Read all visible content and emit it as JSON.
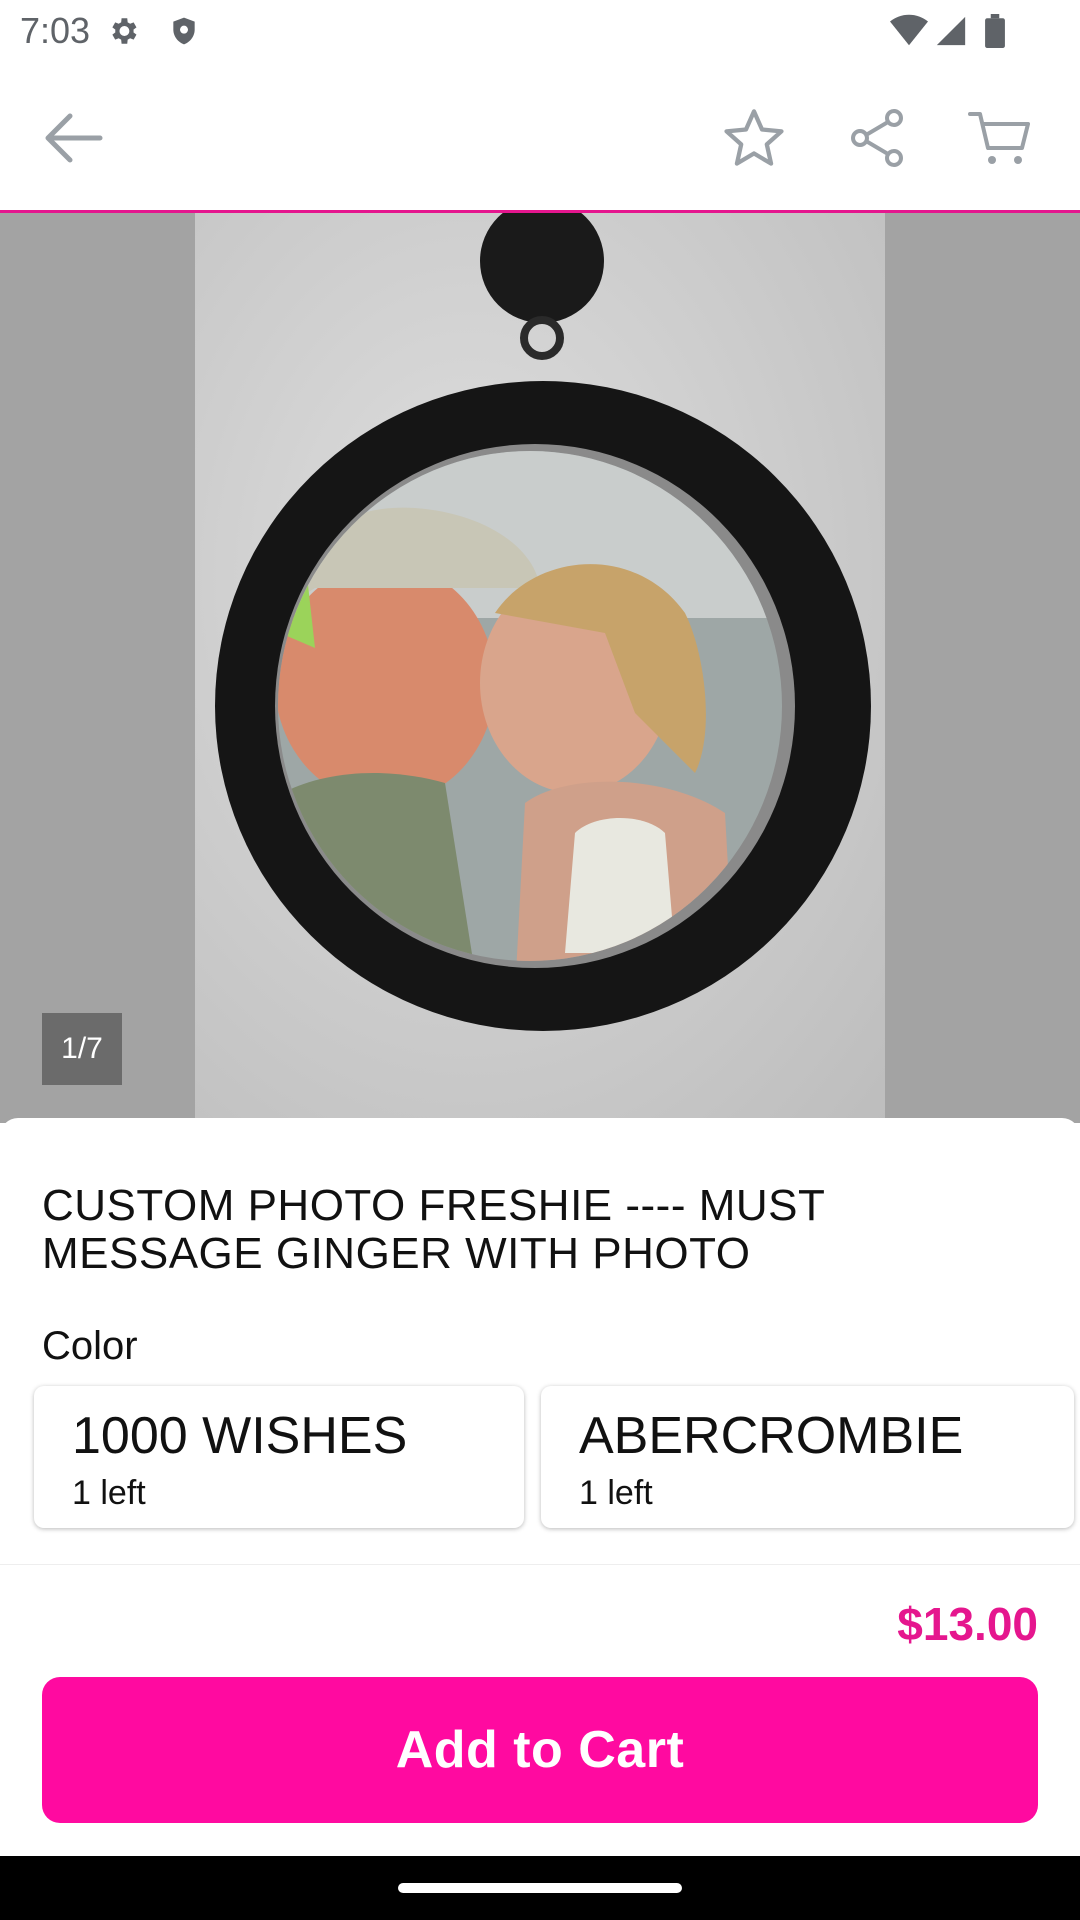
{
  "status_bar": {
    "time": "7:03",
    "icons": [
      "settings-icon",
      "shield-icon",
      "wifi-icon",
      "signal-icon",
      "battery-icon"
    ]
  },
  "toolbar": {
    "icons": [
      "back-arrow-icon",
      "star-icon",
      "share-icon",
      "cart-icon"
    ]
  },
  "gallery": {
    "counter": "1/7"
  },
  "product": {
    "title": "CUSTOM PHOTO FRESHIE ---- MUST MESSAGE GINGER WITH PHOTO",
    "color_label": "Color",
    "options": [
      {
        "name": "1000 WISHES",
        "stock": "1 left"
      },
      {
        "name": "ABERCROMBIE",
        "stock": "1 left"
      }
    ]
  },
  "footer": {
    "price": "$13.00",
    "add_to_cart_label": "Add to Cart"
  },
  "colors": {
    "accent": "#e5168e",
    "button": "#ff0aa0"
  }
}
